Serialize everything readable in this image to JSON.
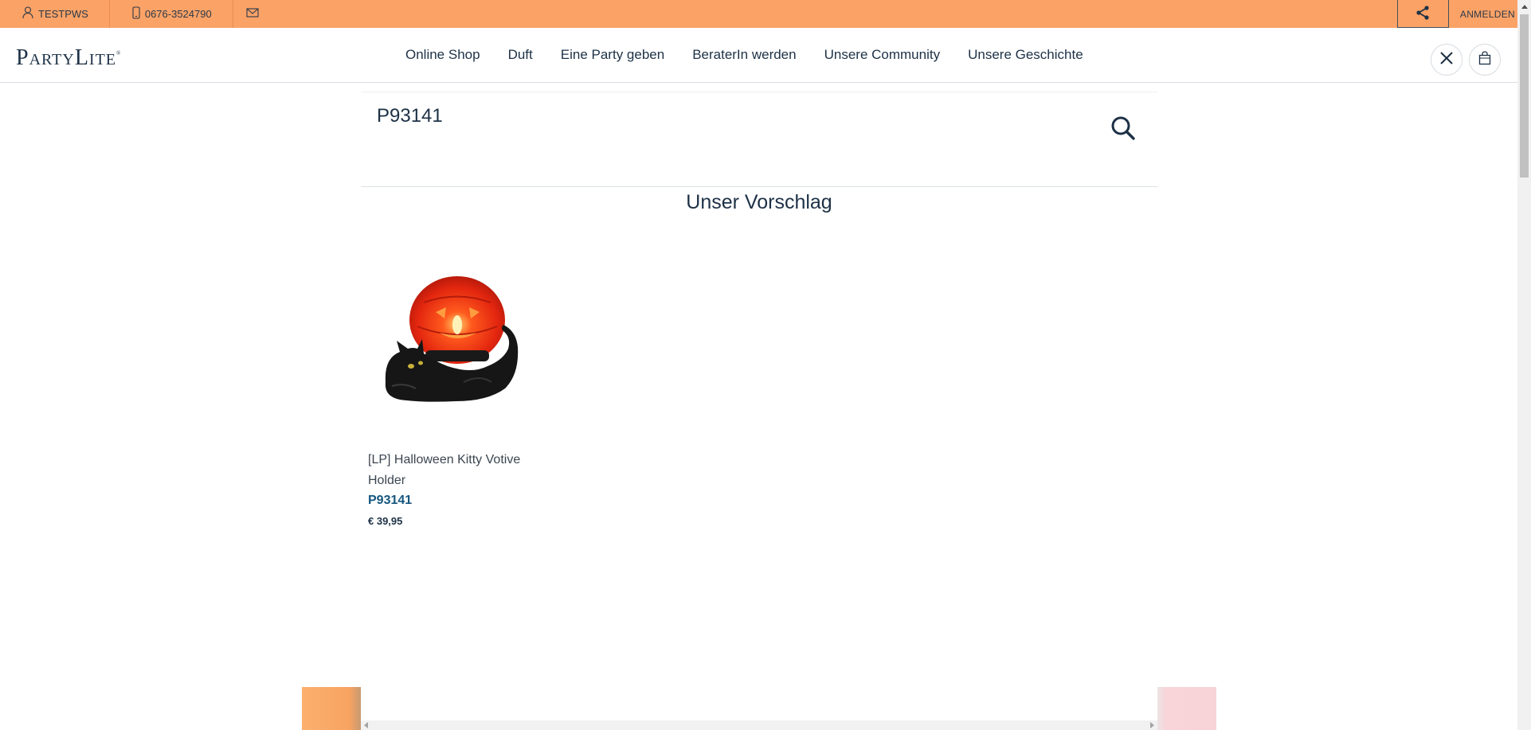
{
  "topbar": {
    "user_label": "TESTPWS",
    "phone": "0676-3524790",
    "login_label": "ANMELDEN",
    "background_color": "#fba266"
  },
  "header": {
    "logo_text": "PartyLite",
    "nav": [
      {
        "label": "Online Shop"
      },
      {
        "label": "Duft"
      },
      {
        "label": "Eine Party geben"
      },
      {
        "label": "BeraterIn werden"
      },
      {
        "label": "Unsere Community"
      },
      {
        "label": "Unsere Geschichte"
      }
    ]
  },
  "search": {
    "value": "P93141"
  },
  "results": {
    "section_title": "Unser Vorschlag",
    "products": [
      {
        "name": "[LP] Halloween Kitty Votive Holder",
        "sku": "P93141",
        "price": "€ 39,95",
        "image": "halloween-kitty-votive-holder"
      }
    ]
  },
  "icons": {
    "user": "user-icon",
    "phone": "phone-icon",
    "mail": "mail-icon",
    "share": "share-icon",
    "close": "close-icon",
    "cart": "shopping-bag-icon",
    "search": "search-icon"
  },
  "colors": {
    "brand_navy": "#1d3146",
    "sku_blue": "#16567e",
    "accent_orange": "#fba266"
  }
}
